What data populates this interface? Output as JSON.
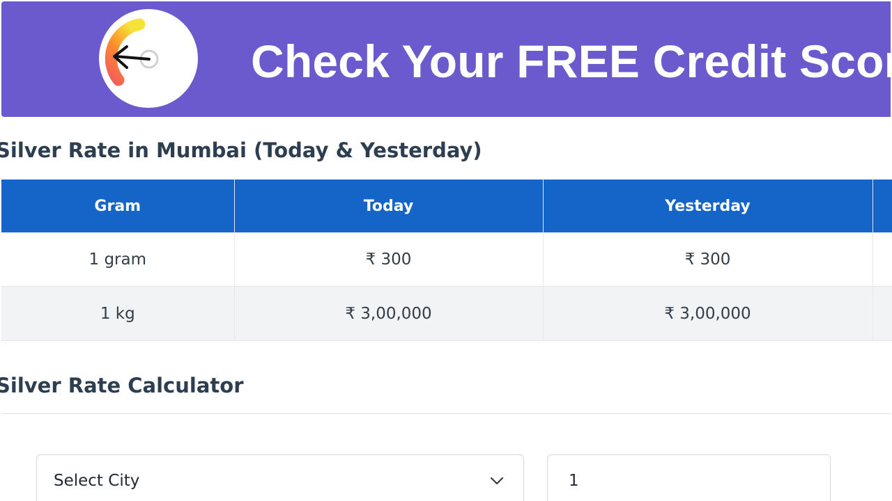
{
  "banner": {
    "title": "Check Your FREE Credit Score",
    "background_color": "#6b5acd",
    "logo_icon": "credit-score-gauge-icon"
  },
  "rates_section": {
    "heading": "Silver Rate in Mumbai (Today & Yesterday)",
    "table": {
      "header_color": "#1565c8",
      "columns": [
        "Gram",
        "Today",
        "Yesterday"
      ],
      "rows": [
        {
          "gram": "1 gram",
          "today": "₹ 300",
          "yesterday": "₹ 300"
        },
        {
          "gram": "1 kg",
          "today": "₹ 3,00,000",
          "yesterday": "₹ 3,00,000"
        }
      ]
    }
  },
  "calculator": {
    "heading": "Silver Rate Calculator",
    "city_select": {
      "value": "Select City",
      "icon": "chevron-down-icon"
    },
    "quantity_input": {
      "value": "1"
    }
  }
}
